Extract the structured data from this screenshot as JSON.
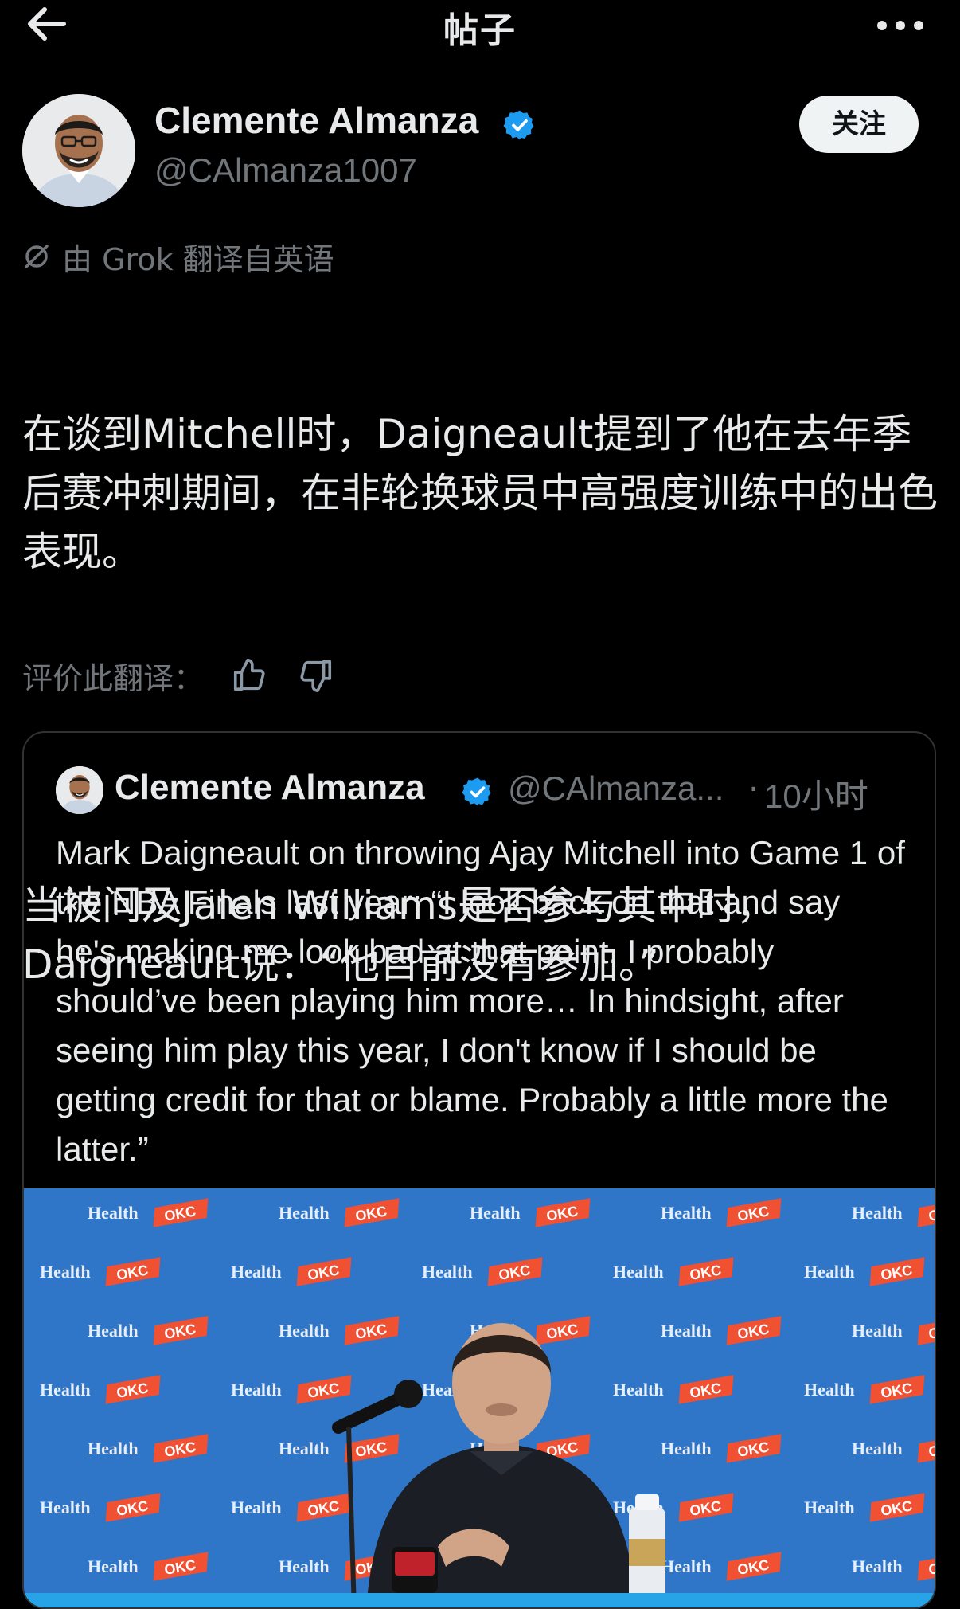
{
  "header": {
    "back_icon": "arrow-left-icon",
    "title": "帖子",
    "more_icon": "more-horizontal-icon"
  },
  "author": {
    "name": "Clemente Almanza",
    "handle": "@CAlmanza1007",
    "verified_color": "#1d9bf0"
  },
  "follow_label": "关注",
  "translation": {
    "notice": "由 Grok 翻译自英语",
    "paragraph1": "在谈到Mitchell时，Daigneault提到了他在去年季后赛冲刺期间，在非轮换球员中高强度训练中的出色表现。",
    "paragraph2": "当被问及Jalen Williams是否参与其中时，Daigneault说：“他目前没有参加。”",
    "rate_label": "评价此翻译：",
    "thumbs_up_icon": "thumbs-up-icon",
    "thumbs_down_icon": "thumbs-down-icon"
  },
  "quoted_post": {
    "name": "Clemente Almanza",
    "handle": "@CAlmanza...",
    "separator": "·",
    "time": "10小时",
    "text": "Mark Daigneault on throwing Ajay Mitchell into Game 1 of the NBA Finals last year: “I look back on that and say he's making me look bad at that point. I probably should’ve been playing him more… In hindsight, after seeing him play this year, I don't know if I should be getting credit for that or blame. Probably a little more the latter.”",
    "media": {
      "backdrop_words": [
        "OKC",
        "Health"
      ],
      "backdrop_color": "#2f76c9"
    }
  }
}
